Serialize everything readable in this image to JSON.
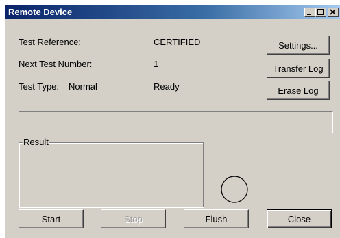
{
  "window": {
    "title": "Remote Device",
    "controls": {
      "minimize_icon": "minimize-icon",
      "maximize_icon": "maximize-icon",
      "close_icon": "close-icon"
    }
  },
  "info": {
    "test_reference_label": "Test Reference:",
    "test_reference_value": "CERTIFIED",
    "next_test_number_label": "Next Test Number:",
    "next_test_number_value": "1",
    "test_type_label": "Test Type:",
    "test_type_value": "Normal",
    "status": "Ready"
  },
  "side_buttons": {
    "settings": "Settings...",
    "transfer_log": "Transfer Log",
    "erase_log": "Erase Log"
  },
  "result_group": {
    "label": "Result"
  },
  "bottom_buttons": {
    "start": "Start",
    "stop": "Stop",
    "flush": "Flush",
    "close": "Close"
  },
  "colors": {
    "face": "#d4d0c8",
    "title_start": "#0a246a",
    "title_end": "#a6caf0",
    "disabled_text": "#a0a0a0"
  }
}
